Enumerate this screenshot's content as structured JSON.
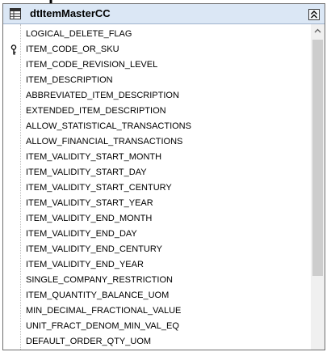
{
  "table": {
    "title": "dtItemMasterCC",
    "icons": {
      "table": "table-icon",
      "collapse": "double-chevron-up-icon",
      "key": "key-icon",
      "cursor": "down-arrow-cursor-icon"
    },
    "fields": [
      {
        "name": "LOGICAL_DELETE_FLAG",
        "key": false
      },
      {
        "name": "ITEM_CODE_OR_SKU",
        "key": true
      },
      {
        "name": "ITEM_CODE_REVISION_LEVEL",
        "key": false
      },
      {
        "name": "ITEM_DESCRIPTION",
        "key": false
      },
      {
        "name": "ABBREVIATED_ITEM_DESCRIPTION",
        "key": false
      },
      {
        "name": "EXTENDED_ITEM_DESCRIPTION",
        "key": false
      },
      {
        "name": "ALLOW_STATISTICAL_TRANSACTIONS",
        "key": false
      },
      {
        "name": "ALLOW_FINANCIAL_TRANSACTIONS",
        "key": false
      },
      {
        "name": "ITEM_VALIDITY_START_MONTH",
        "key": false
      },
      {
        "name": "ITEM_VALIDITY_START_DAY",
        "key": false
      },
      {
        "name": "ITEM_VALIDITY_START_CENTURY",
        "key": false
      },
      {
        "name": "ITEM_VALIDITY_START_YEAR",
        "key": false
      },
      {
        "name": "ITEM_VALIDITY_END_MONTH",
        "key": false
      },
      {
        "name": "ITEM_VALIDITY_END_DAY",
        "key": false
      },
      {
        "name": "ITEM_VALIDITY_END_CENTURY",
        "key": false
      },
      {
        "name": "ITEM_VALIDITY_END_YEAR",
        "key": false
      },
      {
        "name": "SINGLE_COMPANY_RESTRICTION",
        "key": false
      },
      {
        "name": "ITEM_QUANTITY_BALANCE_UOM",
        "key": false
      },
      {
        "name": "MIN_DECIMAL_FRACTIONAL_VALUE",
        "key": false
      },
      {
        "name": "UNIT_FRACT_DENOM_MIN_VAL_EQ",
        "key": false
      },
      {
        "name": "DEFAULT_ORDER_QTY_UOM",
        "key": false
      }
    ]
  },
  "colors": {
    "title_bar": "#dbe7f5",
    "border": "#6f6f6f",
    "scroll_thumb": "#cdcdcd",
    "scroll_track": "#f0f0f0"
  }
}
